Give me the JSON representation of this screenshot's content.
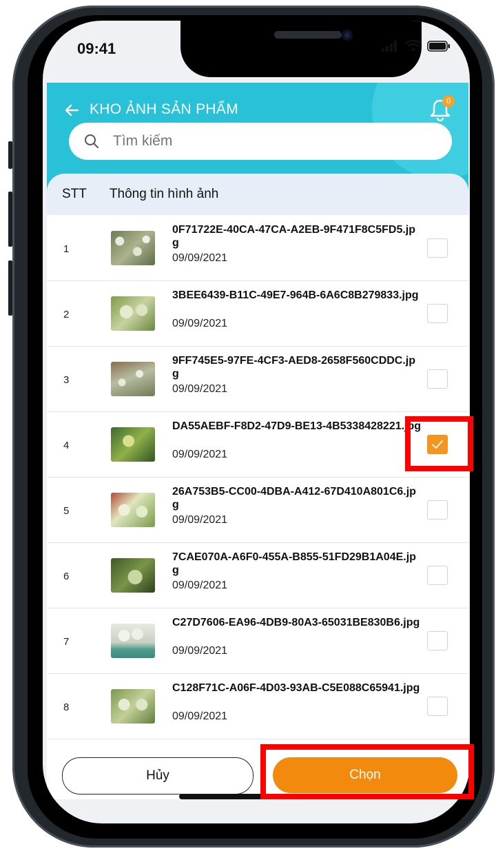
{
  "status_bar": {
    "time": "09:41"
  },
  "header": {
    "title": "KHO ẢNH SẢN PHẨM",
    "notification_count": "0"
  },
  "search": {
    "placeholder": "Tìm kiếm"
  },
  "table": {
    "col_stt": "STT",
    "col_info": "Thông tin hình ảnh",
    "rows": [
      {
        "stt": "1",
        "name": "0F71722E-40CA-47CA-A2EB-9F471F8C5FD5.jpg",
        "date": "09/09/2021",
        "checked": false
      },
      {
        "stt": "2",
        "name": "3BEE6439-B11C-49E7-964B-6A6C8B279833.jpg",
        "date": "09/09/2021",
        "checked": false
      },
      {
        "stt": "3",
        "name": "9FF745E5-97FE-4CF3-AED8-2658F560CDDC.jpg",
        "date": "09/09/2021",
        "checked": false
      },
      {
        "stt": "4",
        "name": "DA55AEBF-F8D2-47D9-BE13-4B5338428221.jpg",
        "date": "09/09/2021",
        "checked": true
      },
      {
        "stt": "5",
        "name": "26A753B5-CC00-4DBA-A412-67D410A801C6.jpg",
        "date": "09/09/2021",
        "checked": false
      },
      {
        "stt": "6",
        "name": "7CAE070A-A6F0-455A-B855-51FD29B1A04E.jpg",
        "date": "09/09/2021",
        "checked": false
      },
      {
        "stt": "7",
        "name": "C27D7606-EA96-4DB9-80A3-65031BE830B6.jpg",
        "date": "09/09/2021",
        "checked": false
      },
      {
        "stt": "8",
        "name": "C128F71C-A06F-4D03-93AB-C5E088C65941.jpg",
        "date": "09/09/2021",
        "checked": false
      }
    ]
  },
  "footer": {
    "cancel_label": "Hủy",
    "choose_label": "Chọn"
  },
  "colors": {
    "header": "#28c1d8",
    "accent": "#f28a0e",
    "highlight": "#ff0000"
  }
}
